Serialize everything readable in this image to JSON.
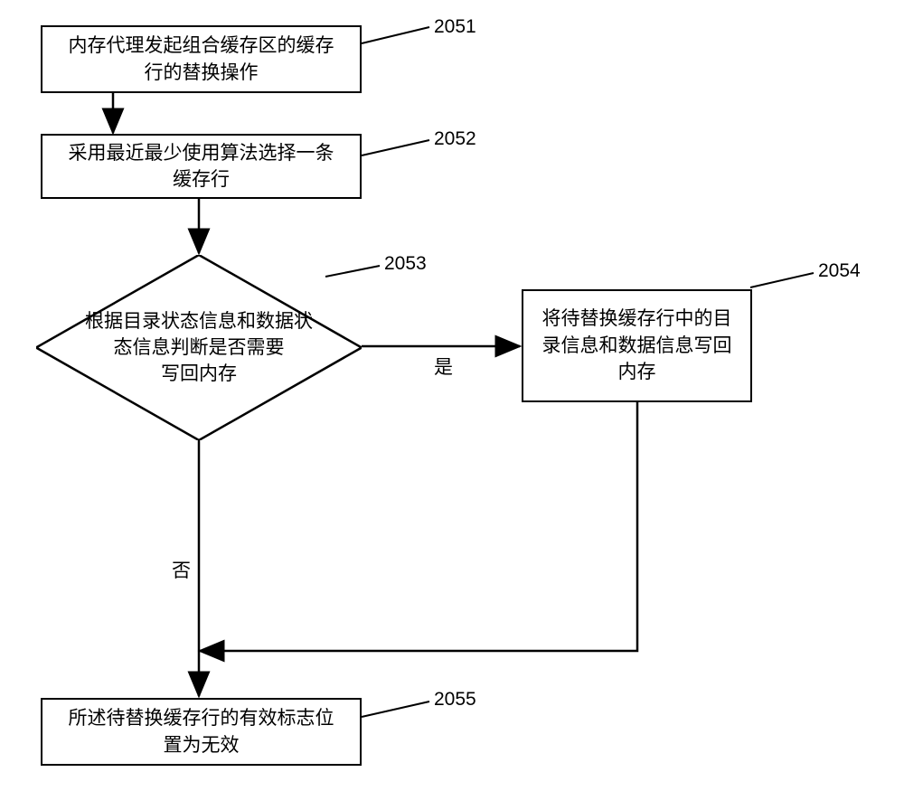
{
  "chart_data": {
    "type": "flowchart",
    "nodes": [
      {
        "id": "2051",
        "type": "process",
        "text": "内存代理发起组合缓存区的缓存行的替换操作"
      },
      {
        "id": "2052",
        "type": "process",
        "text": "采用最近最少使用算法选择一条缓存行"
      },
      {
        "id": "2053",
        "type": "decision",
        "text": "根据目录状态信息和数据状态信息判断是否需要写回内存"
      },
      {
        "id": "2054",
        "type": "process",
        "text": "将待替换缓存行中的目录信息和数据信息写回内存"
      },
      {
        "id": "2055",
        "type": "process",
        "text": "所述待替换缓存行的有效标志位置为无效"
      }
    ],
    "edges": [
      {
        "from": "2051",
        "to": "2052"
      },
      {
        "from": "2052",
        "to": "2053"
      },
      {
        "from": "2053",
        "to": "2054",
        "label": "是"
      },
      {
        "from": "2053",
        "to": "2055",
        "label": "否"
      },
      {
        "from": "2054",
        "to": "2055"
      }
    ]
  },
  "boxes": {
    "b2051": {
      "text": "内存代理发起组合缓存区的缓存\n行的替换操作",
      "label": "2051"
    },
    "b2052": {
      "text": "采用最近最少使用算法选择一条\n缓存行",
      "label": "2052"
    },
    "b2053": {
      "text": "根据目录状态信息和数据状\n态信息判断是否需要\n写回内存",
      "label": "2053"
    },
    "b2054": {
      "text": "将待替换缓存行中的目\n录信息和数据信息写回\n内存",
      "label": "2054"
    },
    "b2055": {
      "text": "所述待替换缓存行的有效标志位\n置为无效",
      "label": "2055"
    }
  },
  "edge_labels": {
    "yes": "是",
    "no": "否"
  }
}
